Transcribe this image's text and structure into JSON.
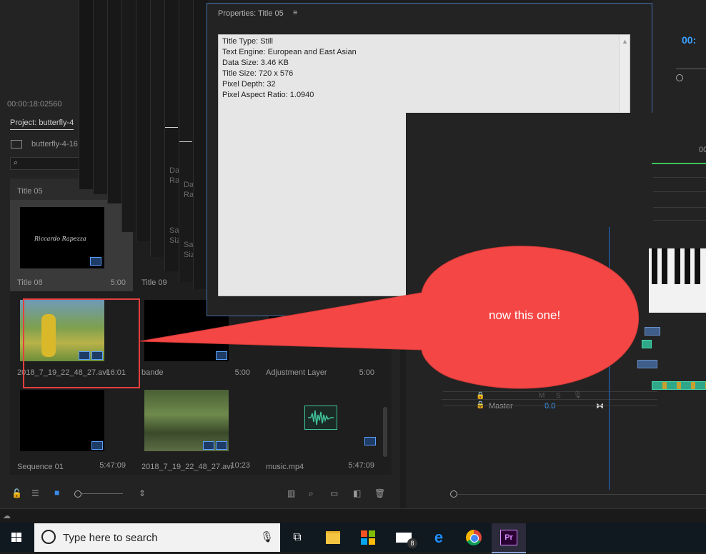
{
  "source_monitor": {
    "timecode": "00:00:18:02560"
  },
  "project": {
    "tab_label": "Project: butterfly-4",
    "path": "butterfly-4-16",
    "items": [
      {
        "name": "Title 05",
        "duration": ""
      },
      {
        "name": "Title 08",
        "duration": "5:00",
        "thumb_caption": "Riccardo Rapezza"
      },
      {
        "name": "Title 09",
        "duration": ""
      },
      {
        "name": "2018_7_19_22_48_27.avi",
        "duration": "16:01"
      },
      {
        "name": "bande",
        "duration": "5:00"
      },
      {
        "name": "Adjustment Layer",
        "duration": "5:00"
      },
      {
        "name": "Sequence 01",
        "duration": "5:47:09"
      },
      {
        "name": "2018_7_19_22_48_27.avi",
        "duration": "10:23"
      },
      {
        "name": "music.mp4",
        "duration": "5:47:09"
      }
    ]
  },
  "stack_labels": [
    "Da",
    "Ra",
    "Sa",
    "Siz"
  ],
  "properties": {
    "title": "Properties: Title 05",
    "menu_icon": "hamburger-icon",
    "lines": [
      "Title Type: Still",
      "Text Engine: European and East Asian",
      "Data Size: 3.46 KB",
      "Title Size: 720 x 576",
      "Pixel Depth: 32",
      "Pixel Aspect Ratio: 1.0940"
    ]
  },
  "program_monitor": {
    "timecode": "00:"
  },
  "timeline": {
    "ruler_label": "00",
    "master_label": "Master",
    "master_value": "0.0",
    "track_letters": [
      "M",
      "S"
    ]
  },
  "callout": {
    "text": "now this one!",
    "color": "#f44745"
  },
  "taskbar": {
    "search_placeholder": "Type here to search",
    "mail_badge": "8",
    "premiere_label": "Pr"
  }
}
